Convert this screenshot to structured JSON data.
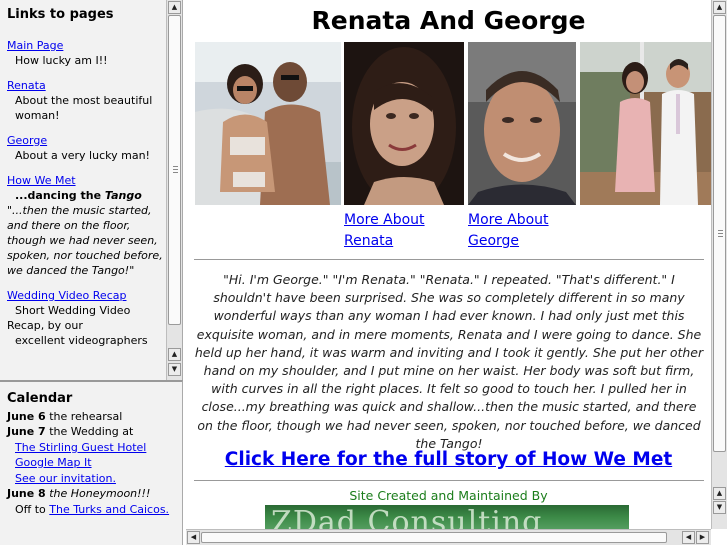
{
  "sidebar": {
    "heading": "Links to pages",
    "links": [
      {
        "label": "Main Page",
        "desc": "How lucky am I!!"
      },
      {
        "label": "Renata",
        "desc": "About the most beautiful woman!"
      },
      {
        "label": "George",
        "desc": "About a very lucky man!"
      }
    ],
    "how_we_met": {
      "label": "How We Met",
      "subtitle_pre": "...dancing the ",
      "subtitle_em": "Tango",
      "quote": "\"...then the music started, and there on the floor, though we had never seen, spoken, nor touched before, we danced the Tango!\""
    },
    "wedding_video": {
      "label": "Wedding Video Recap",
      "desc_line1": "Short Wedding Video",
      "desc_line2": "Recap, by our",
      "desc_line3": "excellent videographers"
    }
  },
  "calendar": {
    "heading": "Calendar",
    "june6_date": "June 6",
    "june6_text": " the rehearsal",
    "june7_date": "June 7",
    "june7_text": " the Wedding at",
    "hotel_link": "The Stirling Guest Hotel",
    "map_link": "Google Map It",
    "invite_link": "See our invitation.",
    "june8_date": "June 8",
    "june8_text": " the Honeymoon!!!",
    "off_to": "Off to ",
    "turks_link": "The Turks and Caicos."
  },
  "main": {
    "title": "Renata And George",
    "more_renata_1": "More About",
    "more_renata_2": "Renata",
    "more_george_1": "More About",
    "more_george_2": "George",
    "story": "\"Hi. I'm George.\" \"I'm Renata.\"  \"Renata.\" I repeated. \"That's different.\" I shouldn't have been surprised. She was so completely different in so many wonderful ways than any woman I had ever known. I had only just met this exquisite woman, and in mere moments, Renata and I were going to dance. She held up her hand, it was warm and inviting and I took it gently. She put her other hand on my shoulder, and I put mine on her waist. Her body was soft but firm, with curves in all the right places. It felt so good to touch her. I pulled her in close...my breathing was quick and shallow...then the music started, and there on the floor, though we had never seen, spoken, nor touched before, we danced the Tango!",
    "cta": "Click Here for the full story of How We Met",
    "site_credit": "Site Created and Maintained By",
    "logo_text": "ZDad Consulting"
  },
  "colors": {
    "link": "#0000ee",
    "credit_green": "#1b7d1b",
    "sidebar_bg": "#f2f2f2"
  }
}
